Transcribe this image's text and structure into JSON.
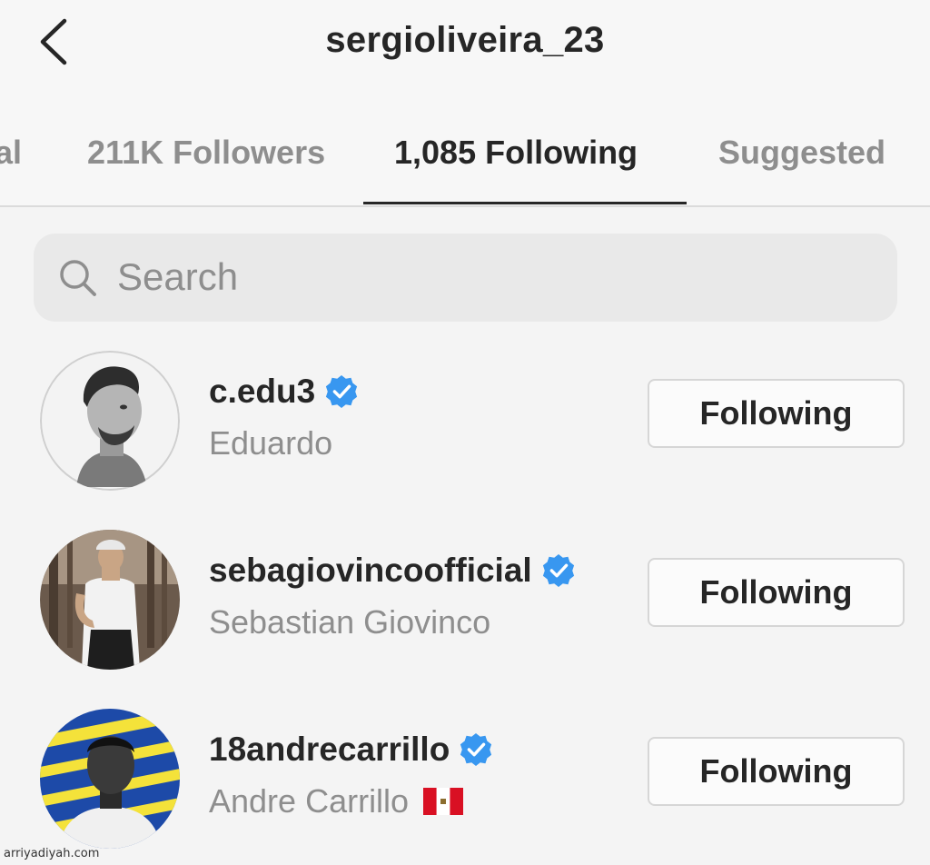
{
  "header": {
    "title": "sergioliveira_23",
    "back_icon": "chevron-left-icon"
  },
  "tabs": [
    {
      "label": "al",
      "active": false
    },
    {
      "label": "211K Followers",
      "active": false
    },
    {
      "label": "1,085 Following",
      "active": true
    },
    {
      "label": "Suggested",
      "active": false
    }
  ],
  "search": {
    "placeholder": "Search",
    "value": "",
    "icon": "search-icon"
  },
  "users": [
    {
      "username": "c.edu3",
      "full_name": "Eduardo",
      "verified": true,
      "flag": "",
      "button_label": "Following",
      "avatar": "profile-photo"
    },
    {
      "username": "sebagiovincoofficial",
      "full_name": "Sebastian Giovinco",
      "verified": true,
      "flag": "",
      "button_label": "Following",
      "avatar": "profile-photo"
    },
    {
      "username": "18andrecarrillo",
      "full_name": "Andre Carrillo",
      "verified": true,
      "flag": "peru-flag",
      "button_label": "Following",
      "avatar": "profile-photo"
    }
  ],
  "watermark": "arriyadiyah.com",
  "colors": {
    "verified_blue": "#3897f0",
    "text_primary": "#262626",
    "text_secondary": "#8e8e8e",
    "flag_red": "#d91023"
  }
}
